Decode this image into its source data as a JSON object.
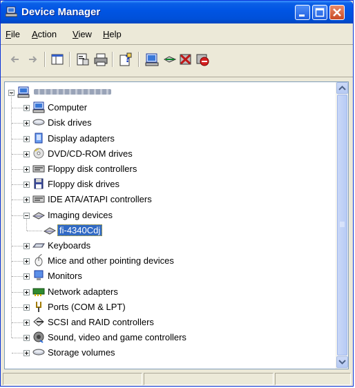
{
  "window": {
    "title": "Device Manager"
  },
  "menu": {
    "items": [
      {
        "label": "File",
        "accel": "F",
        "rest": "ile"
      },
      {
        "label": "Action",
        "accel": "A",
        "rest": "ction"
      },
      {
        "label": "View",
        "accel": "V",
        "rest": "iew"
      },
      {
        "label": "Help",
        "accel": "H",
        "rest": "elp"
      }
    ]
  },
  "toolbar": {
    "buttons": [
      "back-icon",
      "forward-icon",
      "console-tree-icon",
      "properties-icon",
      "print-icon",
      "help-icon",
      "scan-hardware-icon",
      "update-driver-icon",
      "uninstall-icon",
      "disable-icon"
    ]
  },
  "tree": {
    "root": {
      "label": "",
      "icon": "computer-icon"
    },
    "items": [
      {
        "label": "Computer",
        "icon": "computer-icon"
      },
      {
        "label": "Disk drives",
        "icon": "disk-icon"
      },
      {
        "label": "Display adapters",
        "icon": "display-icon"
      },
      {
        "label": "DVD/CD-ROM drives",
        "icon": "cdrom-icon"
      },
      {
        "label": "Floppy disk controllers",
        "icon": "controller-icon"
      },
      {
        "label": "Floppy disk drives",
        "icon": "floppy-icon"
      },
      {
        "label": "IDE ATA/ATAPI controllers",
        "icon": "controller-icon"
      },
      {
        "label": "Imaging devices",
        "icon": "scanner-icon",
        "expanded": true
      },
      {
        "label": "fi-4340Cdj",
        "icon": "scanner-icon",
        "child": true,
        "selected": true
      },
      {
        "label": "Keyboards",
        "icon": "keyboard-icon"
      },
      {
        "label": "Mice and other pointing devices",
        "icon": "mouse-icon"
      },
      {
        "label": "Monitors",
        "icon": "monitor-icon"
      },
      {
        "label": "Network adapters",
        "icon": "network-icon"
      },
      {
        "label": "Ports (COM & LPT)",
        "icon": "port-icon"
      },
      {
        "label": "SCSI and RAID controllers",
        "icon": "scsi-icon"
      },
      {
        "label": "Sound, video and game controllers",
        "icon": "sound-icon"
      },
      {
        "label": "Storage volumes",
        "icon": "storage-icon"
      }
    ]
  },
  "colors": {
    "titlebar": "#0054e3",
    "selection": "#316ac5"
  }
}
